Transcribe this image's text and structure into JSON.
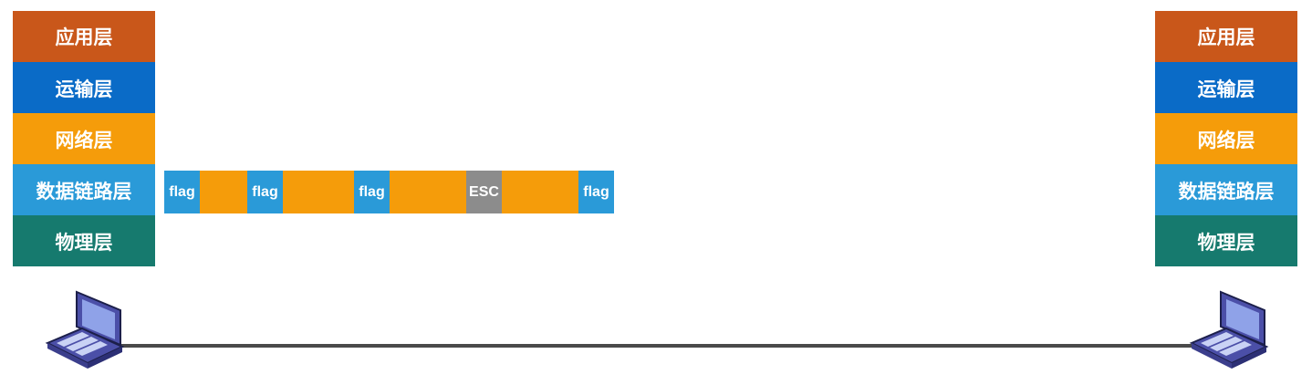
{
  "colors": {
    "application": "#c9571a",
    "transport": "#0a6bc7",
    "network": "#f59c0a",
    "datalink": "#2a9ad8",
    "physical": "#167a6e",
    "flag": "#2a9ad8",
    "data": "#f59c0a",
    "esc": "#8c8c8c",
    "link": "#4a4a4a"
  },
  "left_stack": {
    "layers": [
      {
        "label": "应用层",
        "color": "#c9571a"
      },
      {
        "label": "运输层",
        "color": "#0a6bc7"
      },
      {
        "label": "网络层",
        "color": "#f59c0a"
      },
      {
        "label": "数据链路层",
        "color": "#2a9ad8"
      },
      {
        "label": "物理层",
        "color": "#167a6e"
      }
    ]
  },
  "right_stack": {
    "layers": [
      {
        "label": "应用层",
        "color": "#c9571a"
      },
      {
        "label": "运输层",
        "color": "#0a6bc7"
      },
      {
        "label": "网络层",
        "color": "#f59c0a"
      },
      {
        "label": "数据链路层",
        "color": "#2a9ad8"
      },
      {
        "label": "物理层",
        "color": "#167a6e"
      }
    ]
  },
  "frame": {
    "segments": [
      {
        "type": "flag",
        "label": "flag",
        "color": "#2a9ad8"
      },
      {
        "type": "data",
        "label": "",
        "color": "#f59c0a"
      },
      {
        "type": "flag",
        "label": "flag",
        "color": "#2a9ad8"
      },
      {
        "type": "data",
        "label": "",
        "color": "#f59c0a"
      },
      {
        "type": "flag",
        "label": "flag",
        "color": "#2a9ad8"
      },
      {
        "type": "data",
        "label": "",
        "color": "#f59c0a"
      },
      {
        "type": "esc",
        "label": "ESC",
        "color": "#8c8c8c"
      },
      {
        "type": "data",
        "label": "",
        "color": "#f59c0a"
      },
      {
        "type": "flag",
        "label": "flag",
        "color": "#2a9ad8"
      }
    ]
  },
  "icons": {
    "left_host": "laptop-icon",
    "right_host": "laptop-icon"
  }
}
